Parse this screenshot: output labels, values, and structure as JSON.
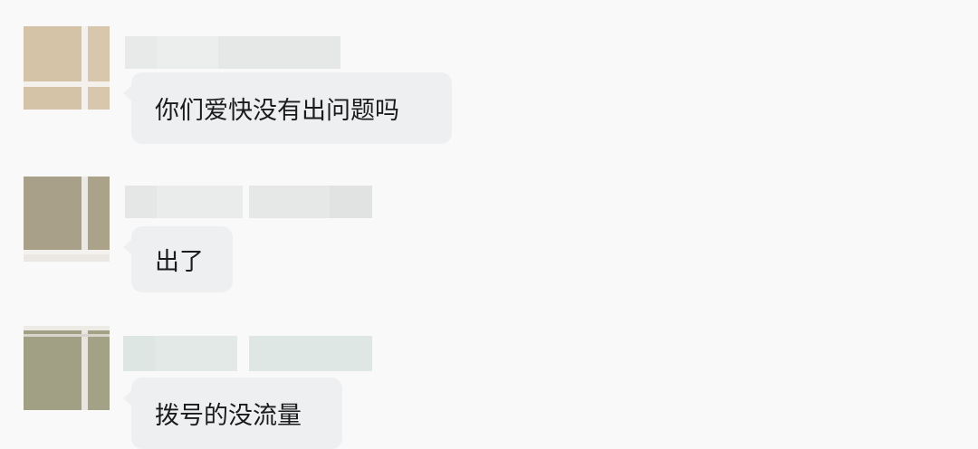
{
  "chat": {
    "messages": [
      {
        "text": "你们爱快没有出问题吗"
      },
      {
        "text": "出了"
      },
      {
        "text": "拨号的没流量"
      }
    ]
  }
}
